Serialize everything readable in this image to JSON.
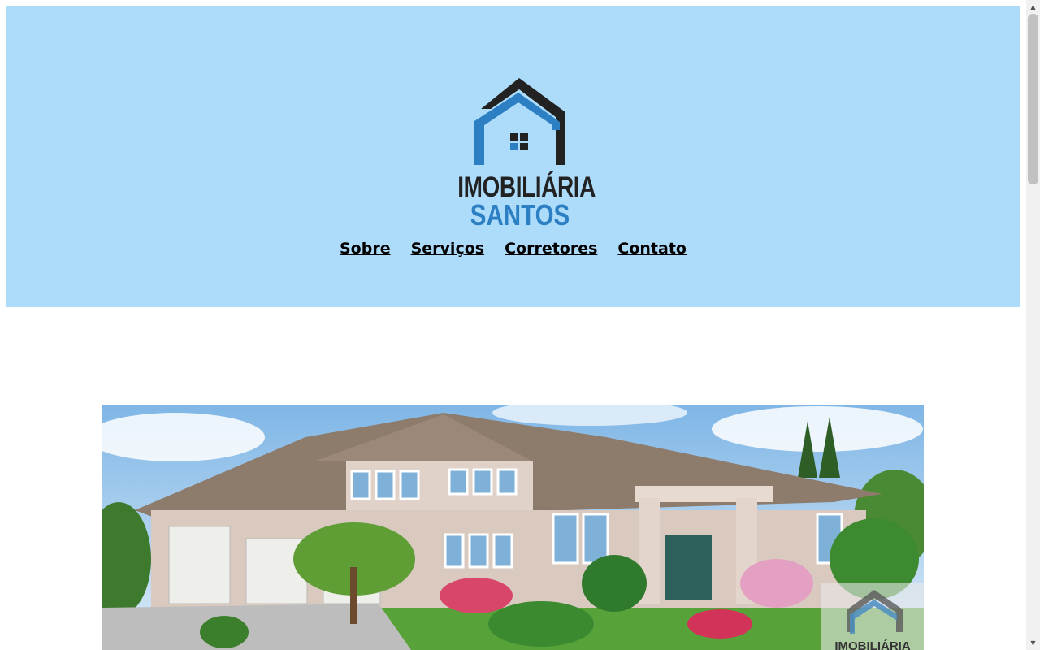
{
  "header": {
    "background": "#addcfb",
    "logo": {
      "line1": "IMOBILIÁRIA",
      "line2": "SANTOS",
      "roof_dark": "#222222",
      "roof_blue": "#2b7fc2"
    }
  },
  "nav": {
    "items": [
      {
        "label": "Sobre"
      },
      {
        "label": "Serviços"
      },
      {
        "label": "Corretores"
      },
      {
        "label": "Contato"
      }
    ]
  },
  "hero": {
    "watermark_text": "IMOBILIÁRIA"
  }
}
